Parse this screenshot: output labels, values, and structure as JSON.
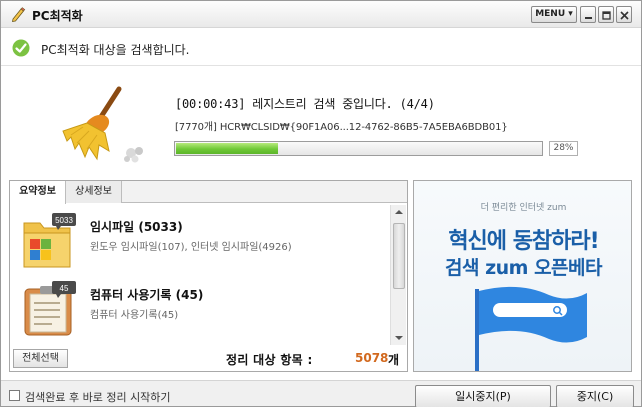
{
  "window": {
    "title": "PC최적화",
    "menu_label": "MENU ▾",
    "icons": [
      "pencil-icon",
      "minimize-icon",
      "maximize-icon",
      "close-icon"
    ]
  },
  "status": {
    "text": "PC최적화 대상을 검색합니다.",
    "icon": "checkmark-icon"
  },
  "scan": {
    "title": "[00:00:43] 레지스트리 검색 중입니다. (4/4)",
    "path": "[7770개] HCR₩CLSID₩{90F1A06...12-4762-86B5-7A5EBA6BDB01}",
    "progress_percent": 28,
    "progress_label": "28%"
  },
  "tabs": [
    {
      "label": "요약정보",
      "active": true
    },
    {
      "label": "상세정보",
      "active": false
    }
  ],
  "items": [
    {
      "badge": "5033",
      "title": "임시파일 (5033)",
      "subtitle": "윈도우 임시파일(107), 인터넷 임시파일(4926)",
      "icon": "temp-files-folder-icon"
    },
    {
      "badge": "45",
      "title": "컴퓨터 사용기록 (45)",
      "subtitle": "컴퓨터 사용기록(45)",
      "icon": "usage-history-clipboard-icon"
    }
  ],
  "summary": {
    "select_all_label": "전체선택",
    "total_label": "정리 대상 항목 :",
    "total_value": "5078",
    "total_unit": "개"
  },
  "ad": {
    "tagline": "더 편리한 인터넷 zum",
    "headline1": "혁신에 동참하라!",
    "headline2": "검색 zum 오픈베타"
  },
  "bottom": {
    "auto_clean_label": "검색완료 후 바로 정리 시작하기",
    "auto_clean_checked": false,
    "pause_label": "일시중지(P)",
    "stop_label": "중지(C)"
  },
  "colors": {
    "progress_green": "#6fc937",
    "total_value_orange": "#d2691e",
    "ad_blue": "#1a5fa8"
  }
}
